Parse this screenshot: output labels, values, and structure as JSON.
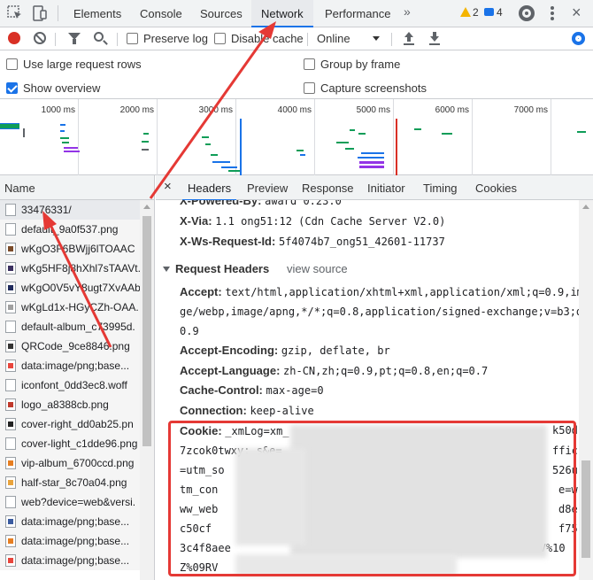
{
  "devtools": {
    "tabs": [
      {
        "label": "Elements"
      },
      {
        "label": "Console"
      },
      {
        "label": "Sources"
      },
      {
        "label": "Network"
      },
      {
        "label": "Performance"
      }
    ],
    "active_tab": "Network",
    "warnings": "2",
    "messages": "4"
  },
  "toolbar": {
    "preserve_log": "Preserve log",
    "disable_cache": "Disable cache",
    "throttle": "Online"
  },
  "settings": {
    "large_rows": "Use large request rows",
    "show_overview": "Show overview",
    "group_by_frame": "Group by frame",
    "capture_screenshots": "Capture screenshots"
  },
  "overview": {
    "ticks": [
      "1000 ms",
      "2000 ms",
      "3000 ms",
      "4000 ms",
      "5000 ms",
      "6000 ms",
      "7000 ms"
    ]
  },
  "list": {
    "header": "Name",
    "items": [
      {
        "name": "33476331/",
        "icon": "document-icon"
      },
      {
        "name": "default_9a0f537.png",
        "icon": "image-icon"
      },
      {
        "name": "wKgO3F6BWjj6lTOAAC",
        "icon": "image-icon"
      },
      {
        "name": "wKg5HF8j8hXhl7sTAAVt.",
        "icon": "image-icon"
      },
      {
        "name": "wKgO0V5vY8ugt7XvAAb",
        "icon": "image-icon"
      },
      {
        "name": "wKgLd1x-HGyCZh-OAA.",
        "icon": "image-icon"
      },
      {
        "name": "default-album_c73995d.",
        "icon": "image-icon"
      },
      {
        "name": "QRCode_9ce8846.png",
        "icon": "image-icon"
      },
      {
        "name": "data:image/png;base...",
        "icon": "image-icon"
      },
      {
        "name": "iconfont_0dd3ec8.woff",
        "icon": "font-icon"
      },
      {
        "name": "logo_a8388cb.png",
        "icon": "image-icon"
      },
      {
        "name": "cover-right_dd0ab25.pn",
        "icon": "image-icon"
      },
      {
        "name": "cover-light_c1dde96.png",
        "icon": "image-icon"
      },
      {
        "name": "vip-album_6700ccd.png",
        "icon": "image-icon"
      },
      {
        "name": "half-star_8c70a04.png",
        "icon": "image-icon"
      },
      {
        "name": "web?device=web&versi.",
        "icon": "document-icon"
      },
      {
        "name": "data:image/png;base...",
        "icon": "image-icon"
      },
      {
        "name": "data:image/png;base...",
        "icon": "image-icon"
      },
      {
        "name": "data:image/png;base...",
        "icon": "image-icon"
      }
    ]
  },
  "detail": {
    "tabs": [
      "Headers",
      "Preview",
      "Response",
      "Initiator",
      "Timing",
      "Cookies"
    ],
    "response_headers_tail": [
      {
        "name": "X-Powered-By:",
        "value": "award 0.23.0"
      },
      {
        "name": "X-Via:",
        "value": "1.1 ong51:12 (Cdn Cache Server V2.0)"
      },
      {
        "name": "X-Ws-Request-Id:",
        "value": "5f4074b7_ong51_42601-11737"
      }
    ],
    "request_headers_title": "Request Headers",
    "view_source": "view source",
    "accept": {
      "name": "Accept:",
      "line1": "text/html,application/xhtml+xml,application/xml;q=0.9,ima",
      "line2": "ge/webp,image/apng,*/*;q=0.8,application/signed-exchange;v=b3;q=",
      "line3": "0.9"
    },
    "accept_encoding": {
      "name": "Accept-Encoding:",
      "value": "gzip, deflate, br"
    },
    "accept_language": {
      "name": "Accept-Language:",
      "value": "zh-CN,zh;q=0.9,pt;q=0.8,en;q=0.7"
    },
    "cache_control": {
      "name": "Cache-Control:",
      "value": "max-age=0"
    },
    "connection": {
      "name": "Connection:",
      "value": "keep-alive"
    },
    "cookie": {
      "name": "Cookie:",
      "line1_start": "_xmLog=xm_",
      "line1_end": "k50d",
      "line2_start": "7zcok0twxy; s&e=",
      "line2_end": "ffic",
      "line3_start": "=utm_so",
      "line3_end": "526u",
      "line4_start": "tm_con",
      "line4_end": "e=w",
      "line5_start": "ww_web",
      "line5_end": "d8e",
      "line6_start": "c50cf",
      "line6_end": "f75",
      "line7_start": "3c4f8aee",
      "line7_end": "%1CV%10",
      "line8_start": "Z%09RV"
    }
  },
  "colors": {
    "accent": "#1a73e8",
    "record": "#d93025",
    "annotation_red": "#e53935"
  }
}
